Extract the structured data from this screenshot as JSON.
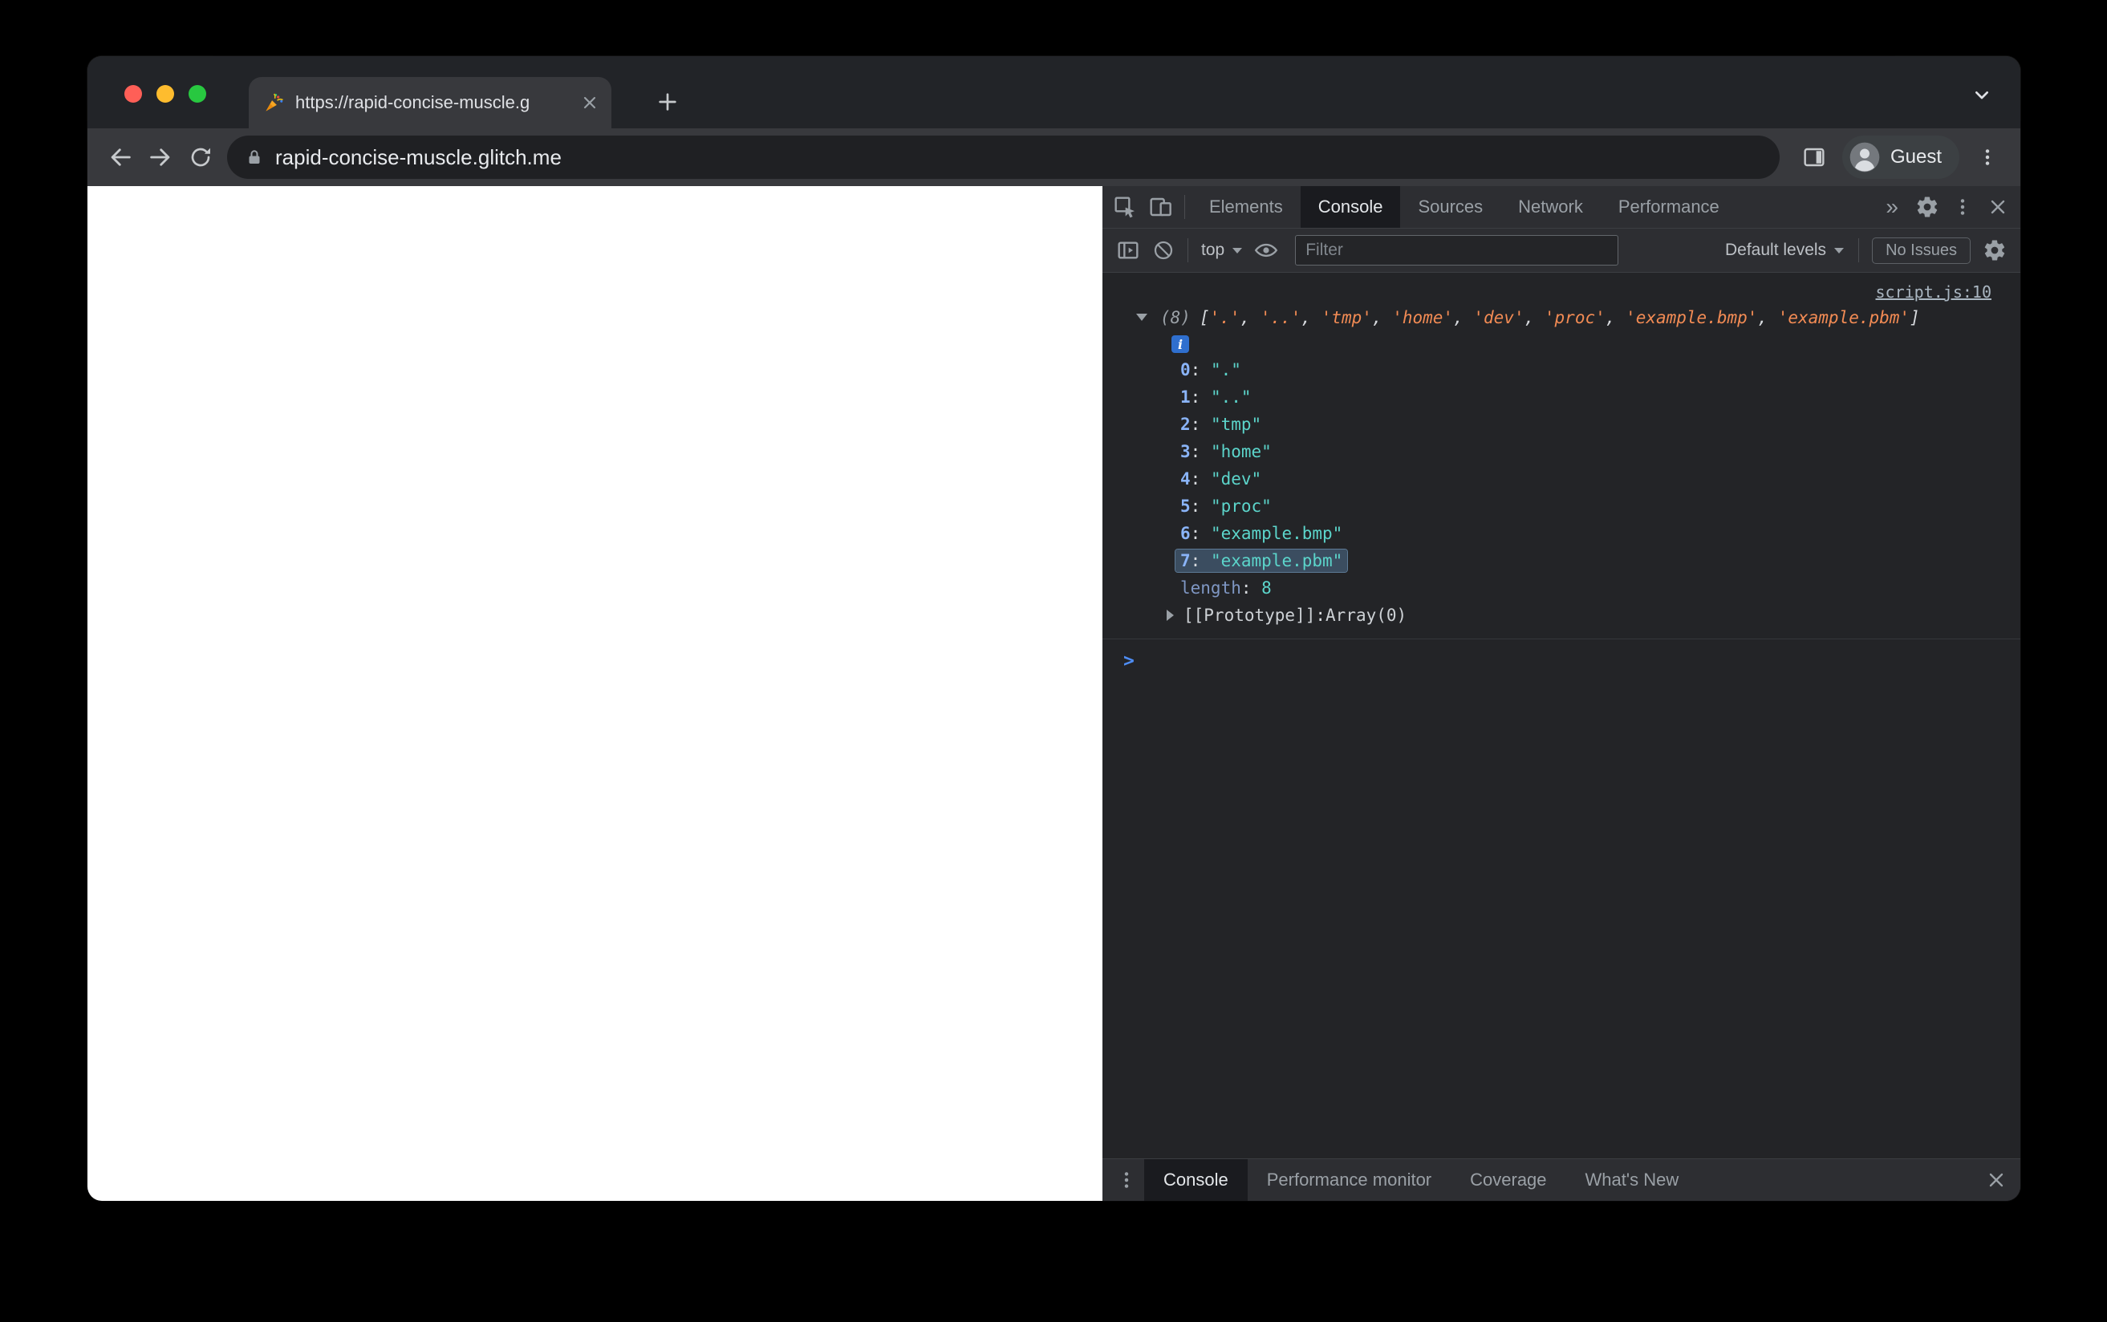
{
  "browser": {
    "tab": {
      "favicon_icon": "party-popper",
      "title": "https://rapid-concise-muscle.g"
    },
    "url": "rapid-concise-muscle.glitch.me",
    "profile_label": "Guest"
  },
  "devtools": {
    "tabs": [
      {
        "label": "Elements",
        "active": false
      },
      {
        "label": "Console",
        "active": true
      },
      {
        "label": "Sources",
        "active": false
      },
      {
        "label": "Network",
        "active": false
      },
      {
        "label": "Performance",
        "active": false
      }
    ],
    "more_tabs_glyph": "»",
    "toolbar": {
      "context": "top",
      "filter_placeholder": "Filter",
      "levels": "Default levels",
      "issues": "No Issues"
    },
    "console": {
      "source_link": "script.js:10",
      "array_count": "(8)",
      "items": [
        ".",
        "..",
        "tmp",
        "home",
        "dev",
        "proc",
        "example.bmp",
        "example.pbm"
      ],
      "highlighted_index": 7,
      "info_badge": "i",
      "length_label": "length",
      "length_value": "8",
      "prototype_label": "[[Prototype]]",
      "prototype_value": "Array(0)",
      "prompt": ">"
    },
    "drawer": {
      "tabs": [
        {
          "label": "Console",
          "active": true
        },
        {
          "label": "Performance monitor",
          "active": false
        },
        {
          "label": "Coverage",
          "active": false
        },
        {
          "label": "What's New",
          "active": false
        }
      ]
    }
  },
  "colors": {
    "traffic_red": "#ff5f57",
    "traffic_yellow": "#febc2e",
    "traffic_green": "#28c840",
    "index_key": "#8ab4f8",
    "string_preview": "#f28b54",
    "string_value": "#5cd5cb",
    "highlight_bg": "#3b4d60",
    "prompt_blue": "#4e8df5"
  }
}
